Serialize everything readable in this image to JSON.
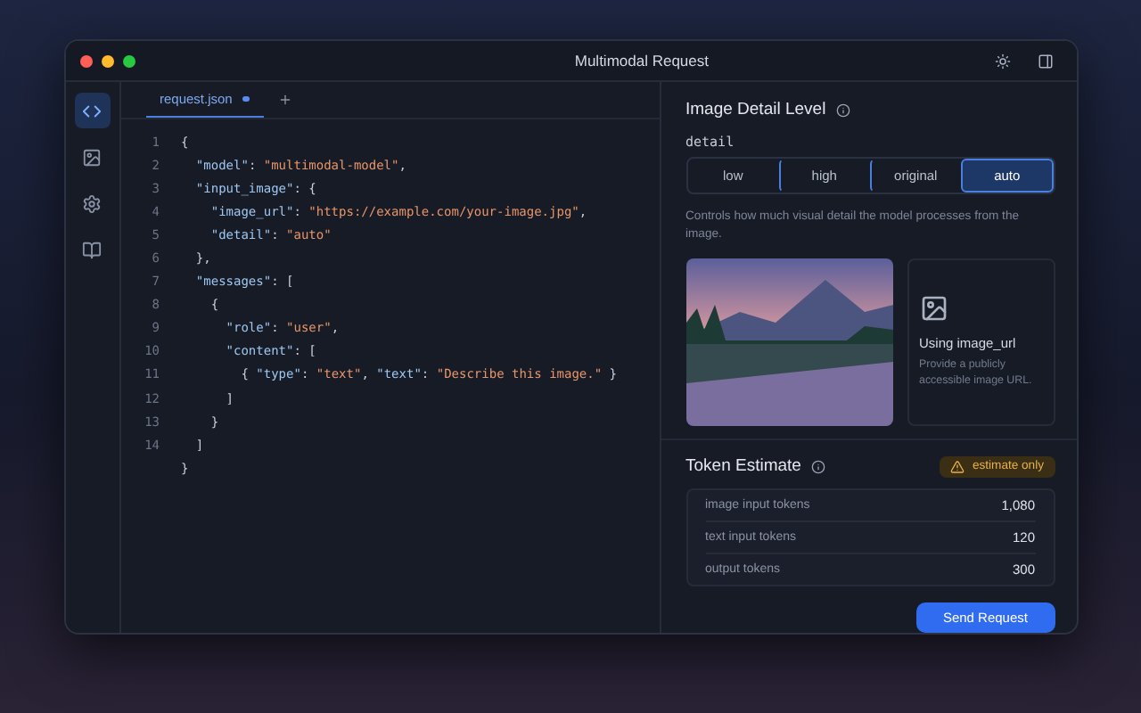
{
  "window": {
    "title": "Multimodal Request"
  },
  "rail": [
    {
      "kind": "code",
      "selected": true
    },
    {
      "kind": "image",
      "selected": false
    },
    {
      "kind": "settings",
      "selected": false
    },
    {
      "kind": "book",
      "selected": false
    }
  ],
  "editor": {
    "tabs": [
      {
        "label": "request.json",
        "selected": true,
        "modified": true
      }
    ],
    "lines": [
      {
        "number": "1",
        "tokens": [
          {
            "kind": "punct",
            "text": "{"
          }
        ]
      },
      {
        "number": "2",
        "tokens": [
          {
            "kind": "key",
            "text": "  \"model\""
          },
          {
            "kind": "punct",
            "text": ": "
          },
          {
            "kind": "string",
            "text": "\"multimodal-model\""
          },
          {
            "kind": "punct",
            "text": ","
          }
        ]
      },
      {
        "number": "3",
        "tokens": [
          {
            "kind": "key",
            "text": "  \"input_image\""
          },
          {
            "kind": "punct",
            "text": ": {"
          }
        ]
      },
      {
        "number": "4",
        "tokens": [
          {
            "kind": "key",
            "text": "    \"image_url\""
          },
          {
            "kind": "punct",
            "text": ": "
          },
          {
            "kind": "string",
            "text": "\"https://example.com/your-image.jpg\""
          },
          {
            "kind": "punct",
            "text": ","
          }
        ]
      },
      {
        "number": "5",
        "tokens": [
          {
            "kind": "key",
            "text": "    \"detail\""
          },
          {
            "kind": "punct",
            "text": ": "
          },
          {
            "kind": "string",
            "text": "\"auto\""
          }
        ]
      },
      {
        "number": "6",
        "tokens": [
          {
            "kind": "punct",
            "text": "  },"
          }
        ]
      },
      {
        "number": "7",
        "tokens": [
          {
            "kind": "key",
            "text": "  \"messages\""
          },
          {
            "kind": "punct",
            "text": ": ["
          }
        ]
      },
      {
        "number": "8",
        "tokens": [
          {
            "kind": "punct",
            "text": "    {"
          }
        ]
      },
      {
        "number": "9",
        "tokens": [
          {
            "kind": "key",
            "text": "      \"role\""
          },
          {
            "kind": "punct",
            "text": ": "
          },
          {
            "kind": "string",
            "text": "\"user\""
          },
          {
            "kind": "punct",
            "text": ","
          }
        ]
      },
      {
        "number": "10",
        "tokens": [
          {
            "kind": "key",
            "text": "      \"content\""
          },
          {
            "kind": "punct",
            "text": ": ["
          }
        ]
      },
      {
        "number": "11",
        "tokens": [
          {
            "kind": "punct",
            "text": "        { "
          },
          {
            "kind": "key",
            "text": "\"type\""
          },
          {
            "kind": "punct",
            "text": ": "
          },
          {
            "kind": "string",
            "text": "\"text\""
          },
          {
            "kind": "punct",
            "text": ", "
          },
          {
            "kind": "key",
            "text": "\"text\""
          },
          {
            "kind": "punct",
            "text": ": "
          },
          {
            "kind": "string",
            "text": "\"Describe this image.\""
          },
          {
            "kind": "punct",
            "text": " }"
          }
        ]
      },
      {
        "number": "12",
        "tokens": [
          {
            "kind": "punct",
            "text": "      ]"
          }
        ]
      },
      {
        "number": "13",
        "tokens": [
          {
            "kind": "punct",
            "text": "    }"
          }
        ]
      },
      {
        "number": "14",
        "tokens": [
          {
            "kind": "punct",
            "text": "  ]"
          }
        ]
      },
      {
        "tokens": [
          {
            "kind": "punct",
            "text": "}"
          }
        ]
      }
    ]
  },
  "detail_panel": {
    "title": "Image Detail Level",
    "field_label": "detail",
    "options": [
      {
        "label": "low",
        "selected": false
      },
      {
        "label": "high",
        "selected": false
      },
      {
        "label": "original",
        "selected": false
      },
      {
        "label": "auto",
        "selected": true
      }
    ],
    "description": "Controls how much visual detail the model processes from the image.",
    "source_card": {
      "title": "Using image_url",
      "hint": "Provide a publicly accessible image URL."
    }
  },
  "token_estimate": {
    "title": "Token Estimate",
    "badge": "estimate only",
    "rows": [
      {
        "label": "image input tokens",
        "value": "1,080"
      },
      {
        "label": "text input tokens",
        "value": "120"
      },
      {
        "label": "output tokens",
        "value": "300"
      }
    ]
  },
  "send_button": "Send Request"
}
